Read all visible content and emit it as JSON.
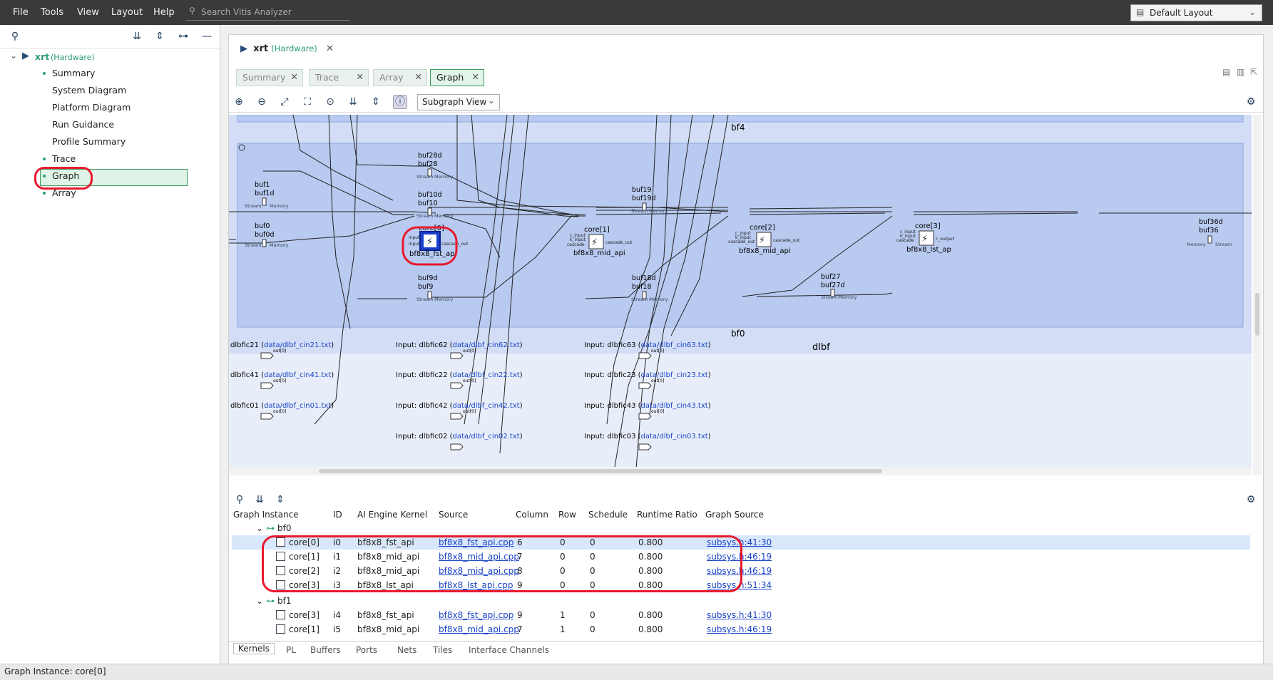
{
  "menu": {
    "file": "File",
    "tools": "Tools",
    "view": "View",
    "layout": "Layout",
    "help": "Help"
  },
  "search": {
    "placeholder": "Search Vitis Analyzer"
  },
  "layout_select": {
    "value": "Default Layout"
  },
  "tree": {
    "root_label": "xrt",
    "root_badge": "(Hardware)",
    "items": [
      {
        "label": "Summary"
      },
      {
        "label": "System Diagram"
      },
      {
        "label": "Platform Diagram"
      },
      {
        "label": "Run Guidance"
      },
      {
        "label": "Profile Summary"
      },
      {
        "label": "Trace"
      },
      {
        "label": "Graph"
      },
      {
        "label": "Array"
      }
    ]
  },
  "main": {
    "title": "xrt",
    "badge": "(Hardware)",
    "tabs": [
      {
        "label": "Summary"
      },
      {
        "label": "Trace"
      },
      {
        "label": "Array"
      },
      {
        "label": "Graph"
      }
    ],
    "subgraph_view": "Subgraph View"
  },
  "graph": {
    "group_labels": {
      "bf4": "bf4",
      "bf0": "bf0",
      "dlbf": "dlbf"
    },
    "buffers": [
      {
        "a": "buf28d",
        "b": "buf28"
      },
      {
        "a": "buf1",
        "b": "buf1d"
      },
      {
        "a": "buf10d",
        "b": "buf10"
      },
      {
        "a": "buf0",
        "b": "buf0d"
      },
      {
        "a": "buf19",
        "b": "buf19d"
      },
      {
        "a": "buf9d",
        "b": "buf9"
      },
      {
        "a": "buf18d",
        "b": "buf18"
      },
      {
        "a": "buf27",
        "b": "buf27d"
      },
      {
        "a": "buf36d",
        "b": "buf36"
      }
    ],
    "port_stream": "Stream",
    "port_memory": "Memory",
    "cores": [
      {
        "name": "core[0]",
        "kernel": "bf8x8_fst_ap"
      },
      {
        "name": "core[1]",
        "kernel": "bf8x8_mid_api"
      },
      {
        "name": "core[2]",
        "kernel": "bf8x8_mid_api"
      },
      {
        "name": "core[3]",
        "kernel": "bf8x8_lst_ap"
      }
    ],
    "core_ports": {
      "input": "input",
      "c_input": "c_input",
      "k_input": "k_input",
      "cascade": "cascade",
      "cascade_out": "cascade_out",
      "c_output": "c_output"
    },
    "inputs": [
      {
        "name": "dlbfic21 (",
        "file": "data/dlbf_cin21.txt",
        "suffix": ")"
      },
      {
        "name": "dlbfic41 (",
        "file": "data/dlbf_cin41.txt",
        "suffix": ")"
      },
      {
        "name": "dlbfic01 (",
        "file": "data/dlbf_cin01.txt",
        "suffix": ")"
      },
      {
        "name": "Input: dlbfic62 (",
        "file": "data/dlbf_cin62.txt",
        "suffix": ")"
      },
      {
        "name": "Input: dlbfic22 (",
        "file": "data/dlbf_cin22.txt",
        "suffix": ")"
      },
      {
        "name": "Input: dlbfic42 (",
        "file": "data/dlbf_cin42.txt",
        "suffix": ")"
      },
      {
        "name": "Input: dlbfic02 (",
        "file": "data/dlbf_cin02.txt",
        "suffix": ")"
      },
      {
        "name": "Input: dlbfic63 (",
        "file": "data/dlbf_cin63.txt",
        "suffix": ")"
      },
      {
        "name": "Input: dlbfic23 (",
        "file": "data/dlbf_cin23.txt",
        "suffix": ")"
      },
      {
        "name": "Input: dlbfic43 (",
        "file": "data/dlbf_cin43.txt",
        "suffix": ")"
      },
      {
        "name": "Input: dlbfic03 (",
        "file": "data/dlbf_cin03.txt",
        "suffix": ")"
      }
    ],
    "out_label": "out[0]"
  },
  "table": {
    "columns": [
      "Graph Instance",
      "ID",
      "AI Engine Kernel",
      "Source",
      "Column",
      "Row",
      "Schedule",
      "Runtime Ratio",
      "Graph Source"
    ],
    "groups": [
      {
        "name": "bf0",
        "rows": [
          {
            "inst": "core[0]",
            "id": "i0",
            "kernel": "bf8x8_fst_api",
            "source": "bf8x8_fst_api.cpp",
            "col": "6",
            "row": "0",
            "sched": "0",
            "ratio": "0.800",
            "gsrc": "subsys.h:41:30"
          },
          {
            "inst": "core[1]",
            "id": "i1",
            "kernel": "bf8x8_mid_api",
            "source": "bf8x8_mid_api.cpp",
            "col": "7",
            "row": "0",
            "sched": "0",
            "ratio": "0.800",
            "gsrc": "subsys.h:46:19"
          },
          {
            "inst": "core[2]",
            "id": "i2",
            "kernel": "bf8x8_mid_api",
            "source": "bf8x8_mid_api.cpp",
            "col": "8",
            "row": "0",
            "sched": "0",
            "ratio": "0.800",
            "gsrc": "subsys.h:46:19"
          },
          {
            "inst": "core[3]",
            "id": "i3",
            "kernel": "bf8x8_lst_api",
            "source": "bf8x8_lst_api.cpp",
            "col": "9",
            "row": "0",
            "sched": "0",
            "ratio": "0.800",
            "gsrc": "subsys.h:51:34"
          }
        ]
      },
      {
        "name": "bf1",
        "rows": [
          {
            "inst": "core[3]",
            "id": "i4",
            "kernel": "bf8x8_fst_api",
            "source": "bf8x8_fst_api.cpp",
            "col": "9",
            "row": "1",
            "sched": "0",
            "ratio": "0.800",
            "gsrc": "subsys.h:41:30"
          },
          {
            "inst": "core[1]",
            "id": "i5",
            "kernel": "bf8x8_mid_api",
            "source": "bf8x8_mid_api.cpp",
            "col": "7",
            "row": "1",
            "sched": "0",
            "ratio": "0.800",
            "gsrc": "subsys.h:46:19"
          }
        ]
      }
    ]
  },
  "bottom_tabs": [
    "Kernels",
    "PL",
    "Buffers",
    "Ports",
    "Nets",
    "Tiles",
    "Interface Channels"
  ],
  "status": "Graph Instance: core[0]",
  "colors": {
    "accent": "#2a9d6f",
    "highlight": "#e8192c",
    "link": "#1b44c8",
    "graph_fill": "#b8caf0"
  }
}
